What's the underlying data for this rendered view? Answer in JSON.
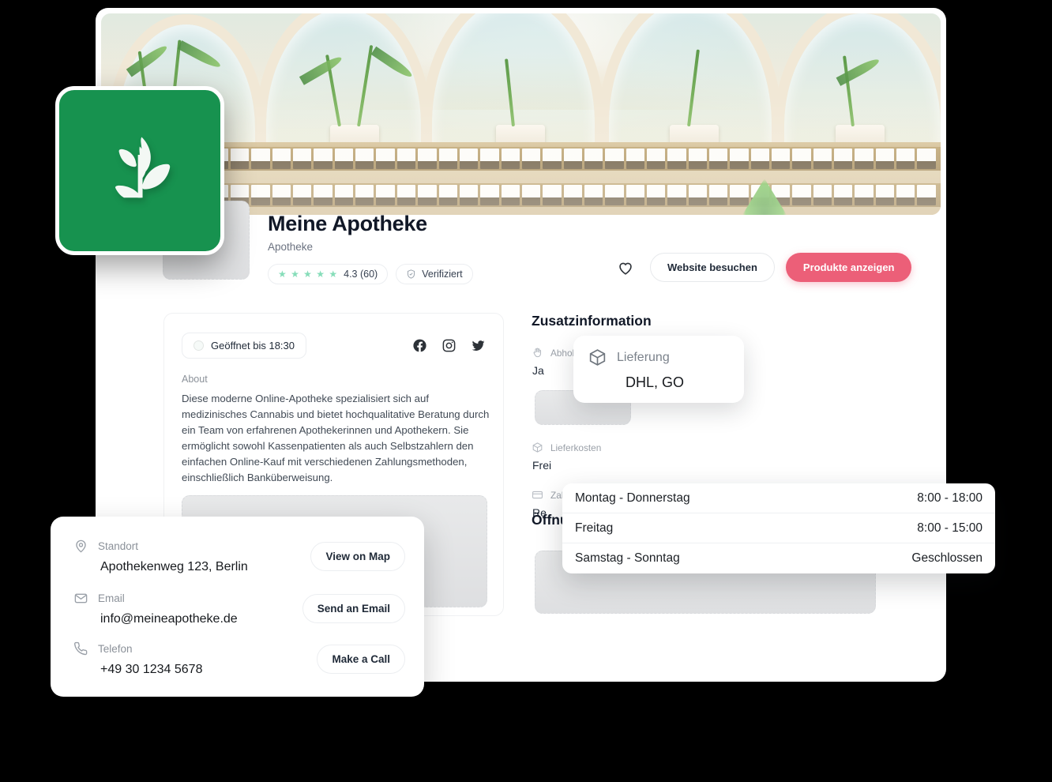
{
  "business": {
    "name": "Meine Apotheke",
    "category": "Apotheke",
    "rating_stars": "★ ★ ★ ★ ★",
    "rating_value": "4.3 (60)",
    "verified_label": "Verifiziert"
  },
  "header_actions": {
    "favorite_icon": "heart-icon",
    "website_label": "Website besuchen",
    "products_label": "Produkte anzeigen",
    "primary_color": "#ec5f78"
  },
  "left_card": {
    "open_status": "Geöffnet bis 18:30",
    "socials": [
      "facebook-icon",
      "instagram-icon",
      "twitter-icon"
    ],
    "about_label": "About",
    "about_text": "Diese moderne Online-Apotheke spezialisiert sich auf medizinisches Cannabis und bietet hochqualitative Beratung durch ein Team von erfahrenen Apothekerinnen und Apothekern. Sie ermöglicht sowohl Kassenpatienten als auch Selbstzahlern den einfachen Online-Kauf mit verschiedenen Zahlungsmethoden, einschließlich Banküberweisung."
  },
  "additional_info": {
    "title": "Zusatzinformation",
    "items": [
      {
        "icon": "hand-icon",
        "label": "Abholung",
        "value": "Ja"
      },
      {
        "icon": "package-icon",
        "label": "Lieferkosten",
        "value": "Frei"
      },
      {
        "icon": "card-icon",
        "label": "Zahlungsmethoden",
        "value": "Re"
      }
    ]
  },
  "opening_hours": {
    "title": "Öffnungszeiten",
    "rows": [
      {
        "days": "Montag - Donnerstag",
        "time": "8:00 - 18:00"
      },
      {
        "days": "Freitag",
        "time": "8:00 - 15:00"
      },
      {
        "days": "Samstag - Sonntag",
        "time": "Geschlossen"
      }
    ]
  },
  "delivery_card": {
    "icon": "package-icon",
    "label": "Lieferung",
    "value": "DHL, GO"
  },
  "contact_card": {
    "rows": [
      {
        "icon": "location-pin-icon",
        "label": "Standort",
        "value": "Apothekenweg 123, Berlin",
        "button": "View on Map"
      },
      {
        "icon": "envelope-icon",
        "label": "Email",
        "value": "info@meineapotheke.de",
        "button": "Send an Email"
      },
      {
        "icon": "phone-icon",
        "label": "Telefon",
        "value": "+49 30 1234 5678",
        "button": "Make a Call"
      }
    ]
  },
  "logo": {
    "icon": "leaf-plant-icon",
    "background_color": "#17924f"
  }
}
